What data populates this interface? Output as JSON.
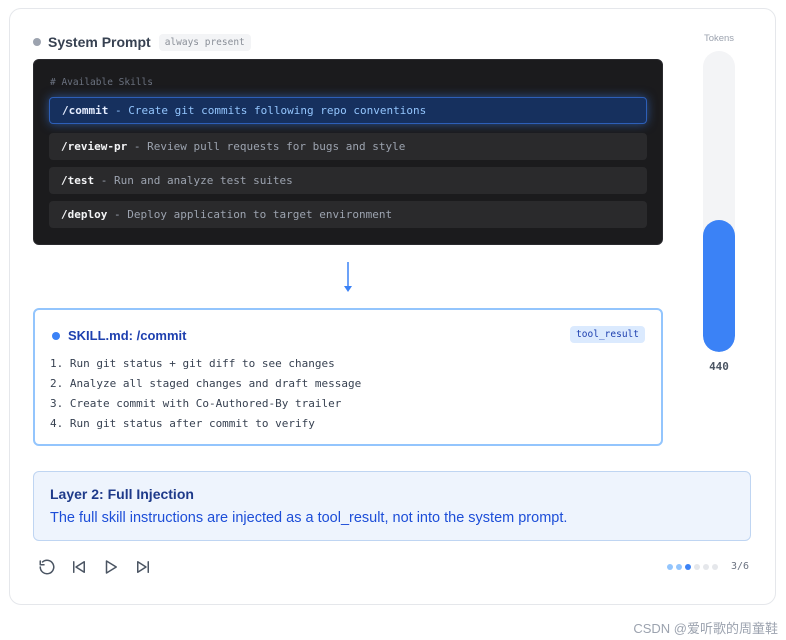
{
  "system_prompt": {
    "title": "System Prompt",
    "badge": "always present",
    "comment": "# Available Skills",
    "skills": [
      {
        "cmd": "/commit",
        "desc": " - Create git commits following repo conventions",
        "active": true
      },
      {
        "cmd": "/review-pr",
        "desc": " - Review pull requests for bugs and style",
        "active": false
      },
      {
        "cmd": "/test",
        "desc": " - Run and analyze test suites",
        "active": false
      },
      {
        "cmd": "/deploy",
        "desc": " - Deploy application to target environment",
        "active": false
      }
    ]
  },
  "skill_file": {
    "title": "SKILL.md: /commit",
    "badge": "tool_result",
    "steps": [
      "1. Run git status + git diff to see changes",
      "2. Analyze all staged changes and draft message",
      "3. Create commit with Co-Authored-By trailer",
      "4. Run git status after commit to verify"
    ]
  },
  "tokens": {
    "label": "Tokens",
    "value": "440",
    "fill_fraction": 0.44
  },
  "layer": {
    "title": "Layer 2: Full Injection",
    "description": "The full skill instructions are injected as a tool_result, not into the system prompt."
  },
  "controls": {
    "icons": [
      "reset-icon",
      "skip-back-icon",
      "play-icon",
      "skip-forward-icon"
    ]
  },
  "pagination": {
    "current": 3,
    "total": 6,
    "label": "3/6"
  },
  "watermark": "CSDN @爱听歌的周童鞋",
  "colors": {
    "accent": "#3b82f6",
    "accent_light": "#93c5fd",
    "panel_dark": "#1b1b1d",
    "layer_bg": "#eef4fd"
  }
}
